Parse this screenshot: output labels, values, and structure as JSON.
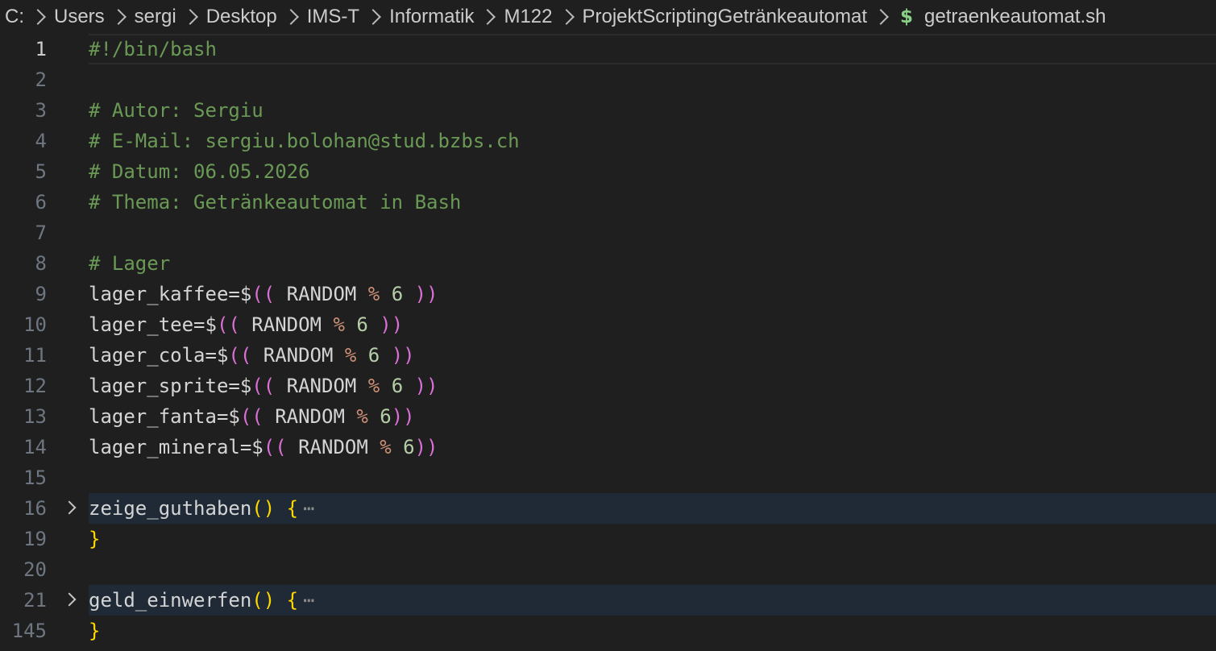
{
  "breadcrumb": {
    "items": [
      "C:",
      "Users",
      "sergi",
      "Desktop",
      "IMS-T",
      "Informatik",
      "M122",
      "ProjektScriptingGetränkeautomat"
    ],
    "file_icon": "$",
    "file_name": "getraenkeautomat.sh"
  },
  "editor": {
    "lines": [
      {
        "num": "1",
        "text": "#!/bin/bash"
      },
      {
        "num": "2",
        "text": ""
      },
      {
        "num": "3",
        "text": "# Autor: Sergiu"
      },
      {
        "num": "4",
        "text": "# E-Mail: sergiu.bolohan@stud.bzbs.ch"
      },
      {
        "num": "5",
        "text": "# Datum: 06.05.2026"
      },
      {
        "num": "6",
        "text": "# Thema: Getränkeautomat in Bash"
      },
      {
        "num": "7",
        "text": ""
      },
      {
        "num": "8",
        "text": "# Lager"
      },
      {
        "num": "9",
        "var": "lager_kaffee=$",
        "open": "((",
        "body": " RANDOM ",
        "op": "%",
        "n": " 6 ",
        "close": "))"
      },
      {
        "num": "10",
        "var": "lager_tee=$",
        "open": "((",
        "body": " RANDOM ",
        "op": "%",
        "n": " 6 ",
        "close": "))"
      },
      {
        "num": "11",
        "var": "lager_cola=$",
        "open": "((",
        "body": " RANDOM ",
        "op": "%",
        "n": " 6 ",
        "close": "))"
      },
      {
        "num": "12",
        "var": "lager_sprite=$",
        "open": "((",
        "body": " RANDOM ",
        "op": "%",
        "n": " 6 ",
        "close": "))"
      },
      {
        "num": "13",
        "var": "lager_fanta=$",
        "open": "((",
        "body": " RANDOM ",
        "op": "%",
        "n": " 6",
        "close": "))"
      },
      {
        "num": "14",
        "var": "lager_mineral=$",
        "open": "((",
        "body": " RANDOM ",
        "op": "%",
        "n": " 6",
        "close": "))"
      },
      {
        "num": "15",
        "text": ""
      },
      {
        "num": "16",
        "fn": "zeige_guthaben",
        "parens": "()",
        "brace": "{",
        "ellipsis": "⋯"
      },
      {
        "num": "19",
        "closing": "}"
      },
      {
        "num": "20",
        "text": ""
      },
      {
        "num": "21",
        "fn": "geld_einwerfen",
        "parens": "()",
        "brace": "{",
        "ellipsis": "⋯"
      },
      {
        "num": "145",
        "closing": "}"
      }
    ]
  }
}
